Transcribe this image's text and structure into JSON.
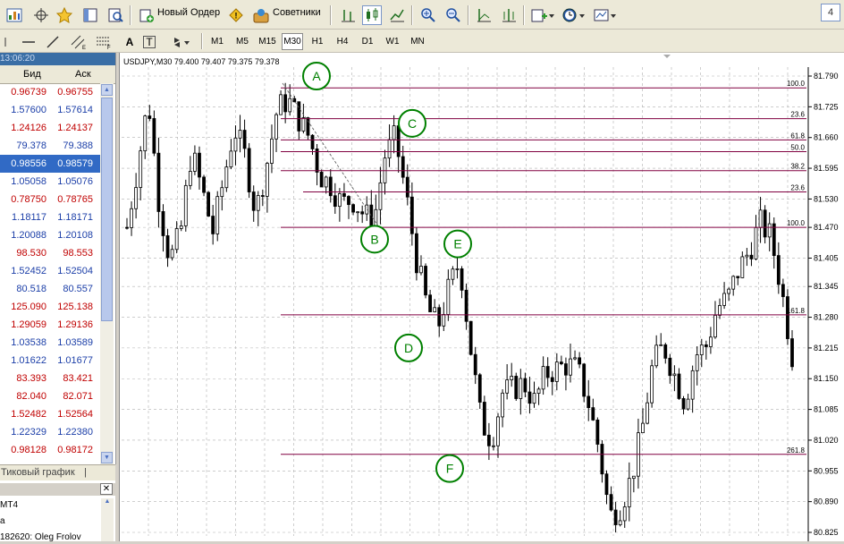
{
  "toolbar": {
    "new_order_label": "Новый Ордер",
    "advisors_label": "Советники",
    "corner_label": "4",
    "timeframes": [
      "M1",
      "M5",
      "M15",
      "M30",
      "H1",
      "H4",
      "D1",
      "W1",
      "MN"
    ],
    "active_timeframe": "M30",
    "text_tool_a": "A",
    "text_tool_t": "T"
  },
  "market_watch": {
    "time": "13:06:20",
    "col_bid": "Бид",
    "col_ask": "Аск",
    "rows": [
      {
        "bid": "0.96739",
        "ask": "0.96755",
        "dir": "dn"
      },
      {
        "bid": "1.57600",
        "ask": "1.57614",
        "dir": "up"
      },
      {
        "bid": "1.24126",
        "ask": "1.24137",
        "dir": "dn"
      },
      {
        "bid": "79.378",
        "ask": "79.388",
        "dir": "up"
      },
      {
        "bid": "0.98556",
        "ask": "0.98579",
        "dir": "sel"
      },
      {
        "bid": "1.05058",
        "ask": "1.05076",
        "dir": "up"
      },
      {
        "bid": "0.78750",
        "ask": "0.78765",
        "dir": "dn"
      },
      {
        "bid": "1.18117",
        "ask": "1.18171",
        "dir": "up"
      },
      {
        "bid": "1.20088",
        "ask": "1.20108",
        "dir": "up"
      },
      {
        "bid": "98.530",
        "ask": "98.553",
        "dir": "dn"
      },
      {
        "bid": "1.52452",
        "ask": "1.52504",
        "dir": "up"
      },
      {
        "bid": "80.518",
        "ask": "80.557",
        "dir": "up"
      },
      {
        "bid": "125.090",
        "ask": "125.138",
        "dir": "dn"
      },
      {
        "bid": "1.29059",
        "ask": "1.29136",
        "dir": "dn"
      },
      {
        "bid": "1.03538",
        "ask": "1.03589",
        "dir": "up"
      },
      {
        "bid": "1.01622",
        "ask": "1.01677",
        "dir": "up"
      },
      {
        "bid": "83.393",
        "ask": "83.421",
        "dir": "dn"
      },
      {
        "bid": "82.040",
        "ask": "82.071",
        "dir": "dn"
      },
      {
        "bid": "1.52482",
        "ask": "1.52564",
        "dir": "dn"
      },
      {
        "bid": "1.22329",
        "ask": "1.22380",
        "dir": "up"
      },
      {
        "bid": "0.98128",
        "ask": "0.98172",
        "dir": "dn"
      }
    ],
    "tab_label": "Тиковый график",
    "tab_sep": "|"
  },
  "navigator": {
    "items": [
      "MT4",
      "a",
      "182620: Oleg Frolov"
    ]
  },
  "chart": {
    "title": "USDJPY,M30  79.400 79.407 79.375 79.378",
    "price_labels": [
      "81.790",
      "81.725",
      "81.660",
      "81.595",
      "81.530",
      "81.470",
      "81.405",
      "81.345",
      "81.280",
      "81.215",
      "81.150",
      "81.085",
      "81.020",
      "80.955",
      "80.890",
      "80.825"
    ],
    "point_labels": [
      "A",
      "B",
      "C",
      "D",
      "E",
      "F"
    ],
    "fib_labels": [
      "100.0",
      "23.6",
      "61.8",
      "50.0",
      "38.2",
      "23.6",
      "100.0",
      "161.8",
      "261.8"
    ],
    "colors": {
      "candle": "#000000",
      "fib": "#800040",
      "point": "#008000",
      "grid": "#b0b0b0"
    }
  },
  "chart_data": {
    "type": "candlestick",
    "title": "USDJPY,M30  79.400 79.407 79.375 79.378",
    "ylim": [
      80.825,
      81.79
    ],
    "y_ticks": [
      81.79,
      81.725,
      81.66,
      81.595,
      81.53,
      81.47,
      81.405,
      81.345,
      81.28,
      81.215,
      81.15,
      81.085,
      81.02,
      80.955,
      80.89,
      80.825
    ],
    "close_path": [
      81.47,
      81.6,
      81.74,
      81.52,
      81.4,
      81.46,
      81.63,
      81.55,
      81.46,
      81.57,
      81.68,
      81.62,
      81.5,
      81.6,
      81.72,
      81.74,
      81.7,
      81.66,
      81.58,
      81.56,
      81.52,
      81.53,
      81.5,
      81.48,
      81.62,
      81.66,
      81.54,
      81.4,
      81.3,
      81.26,
      81.34,
      81.4,
      81.22,
      81.06,
      81.02,
      81.12,
      81.13,
      81.14,
      81.1,
      81.16,
      81.17,
      81.18,
      81.17,
      81.1,
      81.0,
      80.86,
      80.88,
      80.94,
      81.04,
      81.18,
      81.22,
      81.16,
      81.1,
      81.2,
      81.22,
      81.3,
      81.32,
      81.38,
      81.42,
      81.48,
      81.45,
      81.34,
      81.2
    ],
    "points": {
      "A": 81.76,
      "B": 81.47,
      "C": 81.66,
      "D": 81.27,
      "E": 81.4,
      "F": 80.97
    }
  }
}
